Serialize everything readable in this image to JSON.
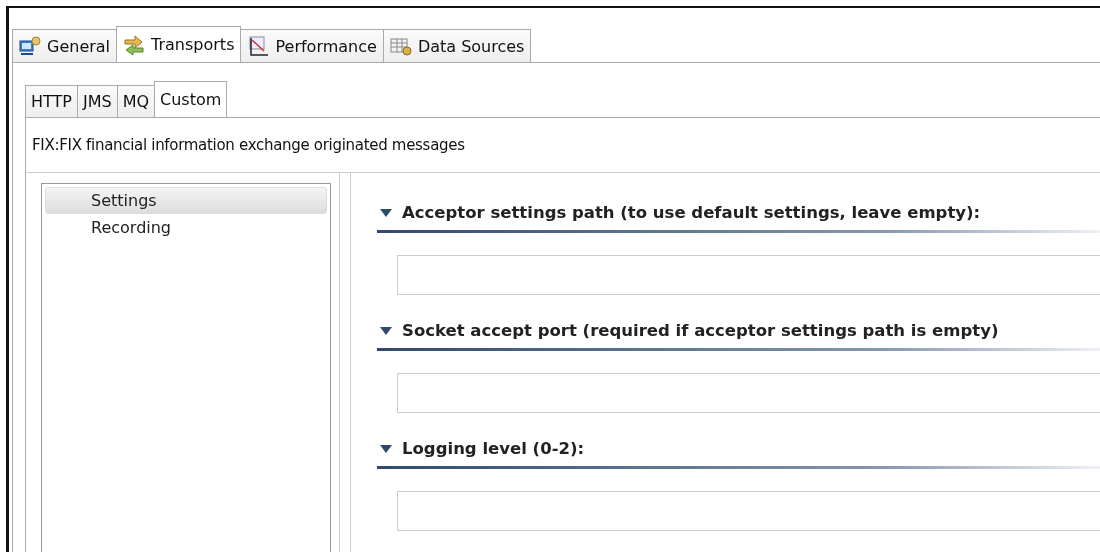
{
  "main_tabs": [
    {
      "label": "General",
      "kind": "monitor",
      "selected": false
    },
    {
      "label": "Transports",
      "kind": "arrows",
      "selected": true
    },
    {
      "label": "Performance",
      "kind": "chart",
      "selected": false
    },
    {
      "label": "Data Sources",
      "kind": "table",
      "selected": false
    }
  ],
  "sub_tabs": [
    {
      "label": "HTTP",
      "selected": false
    },
    {
      "label": "JMS",
      "selected": false
    },
    {
      "label": "MQ",
      "selected": false
    },
    {
      "label": "Custom",
      "selected": true
    }
  ],
  "description": "FIX:FIX financial information exchange originated messages",
  "tree": [
    {
      "label": "Settings",
      "selected": true
    },
    {
      "label": "Recording",
      "selected": false
    }
  ],
  "sections": [
    {
      "title": "Acceptor settings path (to use default settings, leave empty):",
      "expanded": true
    },
    {
      "title": "Socket accept port (required if acceptor settings path is empty)",
      "expanded": true
    },
    {
      "title": "Logging level (0-2):",
      "expanded": true
    }
  ]
}
